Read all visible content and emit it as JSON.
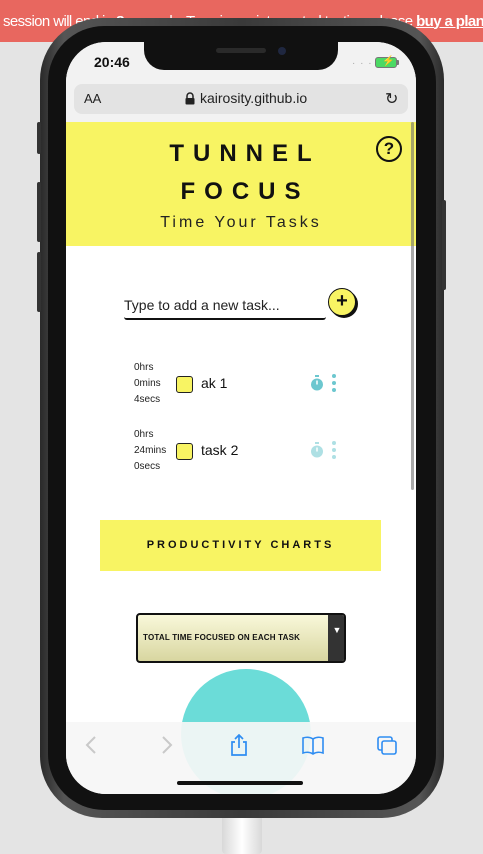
{
  "banner": {
    "text_before": "session will end in ",
    "seconds": "8",
    "text_after": " seconds. To enjoy uninterrupted testing, please ",
    "link": "buy a plan",
    "end": "."
  },
  "status": {
    "time": "20:46"
  },
  "browser": {
    "text_size": "AA",
    "url": "kairosity.github.io"
  },
  "app": {
    "title_line1": "TUNNEL",
    "title_line2": "FOCUS",
    "subtitle": "Time Your Tasks",
    "help": "?",
    "new_task_placeholder": "Type to add a new task...",
    "add_label": "+",
    "tasks": [
      {
        "hrs": "0hrs",
        "mins": "0mins",
        "secs": "4secs",
        "name": "ak 1"
      },
      {
        "hrs": "0hrs",
        "mins": "24mins",
        "secs": "0secs",
        "name": "task 2"
      }
    ],
    "charts_button": "PRODUCTIVITY CHARTS",
    "chart_select": "TOTAL TIME FOCUSED ON EACH TASK"
  },
  "colors": {
    "banner_bg": "#e8675f",
    "accent_yellow": "#f8f463",
    "accent_teal": "#6cc7cf"
  },
  "icons": [
    "lock-icon",
    "reload-icon",
    "help-icon",
    "timer-icon",
    "more-vertical-icon",
    "back-icon",
    "forward-icon",
    "share-icon",
    "bookmarks-icon",
    "tabs-icon"
  ]
}
